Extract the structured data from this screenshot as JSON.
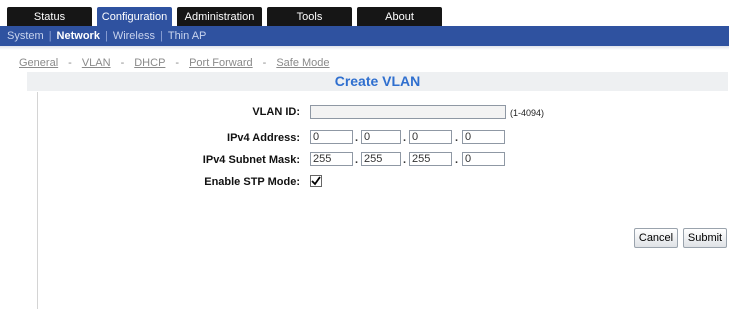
{
  "top_nav": [
    {
      "label": "Status",
      "active": false
    },
    {
      "label": "Configuration",
      "active": true
    },
    {
      "label": "Administration",
      "active": false
    },
    {
      "label": "Tools",
      "active": false
    },
    {
      "label": "About",
      "active": false
    }
  ],
  "sub_nav": [
    {
      "label": "System",
      "active": false
    },
    {
      "label": "Network",
      "active": true
    },
    {
      "label": "Wireless",
      "active": false
    },
    {
      "label": "Thin AP",
      "active": false
    }
  ],
  "breadcrumbs": [
    "General",
    "VLAN",
    "DHCP",
    "Port Forward",
    "Safe Mode"
  ],
  "breadcrumb_separator": "-",
  "page_title": "Create VLAN",
  "form": {
    "vlan_id": {
      "label": "VLAN ID:",
      "value": "",
      "hint": "(1-4094)"
    },
    "ipv4_address": {
      "label": "IPv4 Address:",
      "octets": [
        "0",
        "0",
        "0",
        "0"
      ]
    },
    "ipv4_subnet_mask": {
      "label": "IPv4 Subnet Mask:",
      "octets": [
        "255",
        "255",
        "255",
        "0"
      ]
    },
    "octet_separator": ".",
    "enable_stp": {
      "label": "Enable STP Mode:",
      "checked": true
    }
  },
  "buttons": {
    "cancel": "Cancel",
    "submit": "Submit"
  },
  "colors": {
    "accent": "#2f52a0",
    "tab_bg": "#161616",
    "title_text": "#2f6fcf"
  }
}
